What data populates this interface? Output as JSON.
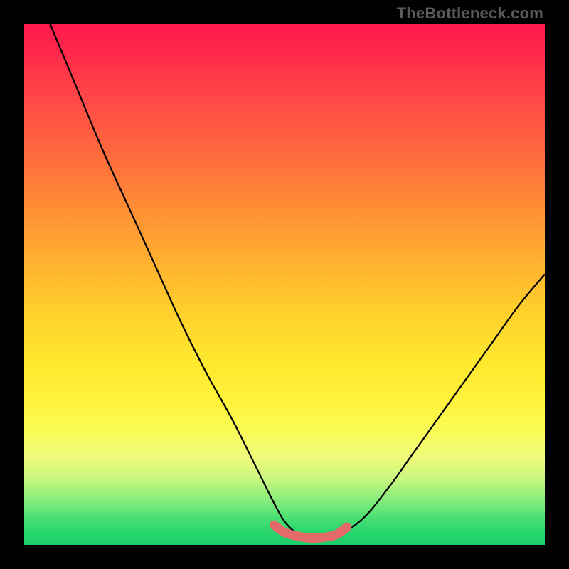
{
  "watermark": {
    "text": "TheBottleneck.com"
  },
  "colors": {
    "frame": "#000000",
    "curve": "#000000",
    "highlight": "#e46a6a",
    "gradient_top": "#ff1a4d",
    "gradient_bottom": "#1fce6a"
  },
  "chart_data": {
    "type": "line",
    "title": "",
    "xlabel": "",
    "ylabel": "",
    "xlim": [
      0,
      100
    ],
    "ylim": [
      0,
      100
    ],
    "grid": false,
    "legend": false,
    "series": [
      {
        "name": "bottleneck-curve",
        "x": [
          5,
          10,
          15,
          20,
          25,
          30,
          35,
          40,
          45,
          48,
          50,
          52,
          54,
          56,
          58,
          60,
          65,
          70,
          75,
          80,
          85,
          90,
          95,
          100
        ],
        "y": [
          100,
          88,
          76,
          65,
          54,
          43,
          33,
          24,
          14,
          8,
          4.5,
          2.5,
          1.6,
          1.3,
          1.3,
          1.6,
          5,
          11,
          18,
          25,
          32,
          39,
          46,
          52
        ]
      },
      {
        "name": "valley-highlight",
        "x": [
          48,
          50,
          52,
          54,
          56,
          58,
          60,
          62
        ],
        "y": [
          3.8,
          2.4,
          1.8,
          1.4,
          1.3,
          1.5,
          2.0,
          3.4
        ]
      }
    ],
    "annotations": []
  }
}
